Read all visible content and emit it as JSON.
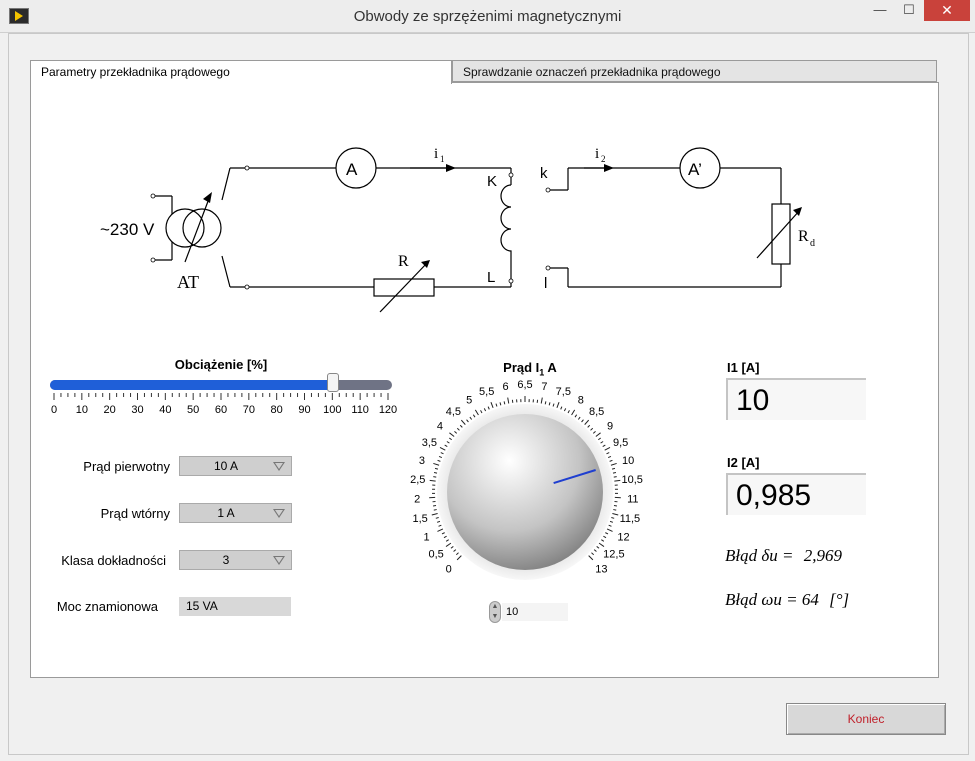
{
  "window": {
    "title": "Obwody ze sprzężenimi magnetycznymi",
    "minimize": "—",
    "maximize": "☐",
    "close": "✕"
  },
  "tabs": [
    {
      "label": "Parametry przekładnika prądowego",
      "active": true
    },
    {
      "label": "Sprawdzanie oznaczeń przekładnika prądowego",
      "active": false
    }
  ],
  "circuit": {
    "source": "~230 V",
    "autotransformer": "AT",
    "ammeter1": "A",
    "ammeter2": "A’",
    "current1": "i",
    "current1_sub": "1",
    "current2": "i",
    "current2_sub": "2",
    "terminal_K": "K",
    "terminal_L": "L",
    "terminal_k": "k",
    "terminal_l": "l",
    "resistor": "R",
    "load": "R",
    "load_sub": "d"
  },
  "load_slider": {
    "title": "Obciążenie [%]",
    "value": 100,
    "min": 0,
    "max": 120,
    "ticks": [
      "0",
      "10",
      "20",
      "30",
      "40",
      "50",
      "60",
      "70",
      "80",
      "90",
      "100",
      "110",
      "120"
    ]
  },
  "settings": {
    "primary_label": "Prąd pierwotny",
    "primary_value": "10 A",
    "secondary_label": "Prąd wtórny",
    "secondary_value": "1 A",
    "class_label": "Klasa dokładności",
    "class_value": "3",
    "power_label": "Moc znamionowa",
    "power_value": "15 VA"
  },
  "knob": {
    "title": "Prąd I",
    "title_sub": "1",
    "title_unit": " A",
    "value": 10,
    "value_text": "10",
    "min": 0,
    "max": 13,
    "labels": [
      "0",
      "0,5",
      "1",
      "1,5",
      "2",
      "2,5",
      "3",
      "3,5",
      "4",
      "4,5",
      "5",
      "5,5",
      "6",
      "6,5",
      "7",
      "7,5",
      "8",
      "8,5",
      "9",
      "9,5",
      "10",
      "10,5",
      "11",
      "11,5",
      "12",
      "12,5",
      "13"
    ],
    "spin_up": "▲",
    "spin_down": "▼"
  },
  "indicators": {
    "i1_label": "I1 [A]",
    "i1_value": "10",
    "i2_label": "I2 [A]",
    "i2_value": "0,985"
  },
  "errors": {
    "delta_label": "Błąd δu =",
    "delta_value": "2,969",
    "omega_label": "Błąd ωu =",
    "omega_value": "64",
    "omega_unit": "[°]"
  },
  "buttons": {
    "exit": "Koniec"
  },
  "colors": {
    "slider_fill": "#1f5fd8",
    "needle": "#1f3fd0",
    "exit_text": "#c0202a"
  }
}
